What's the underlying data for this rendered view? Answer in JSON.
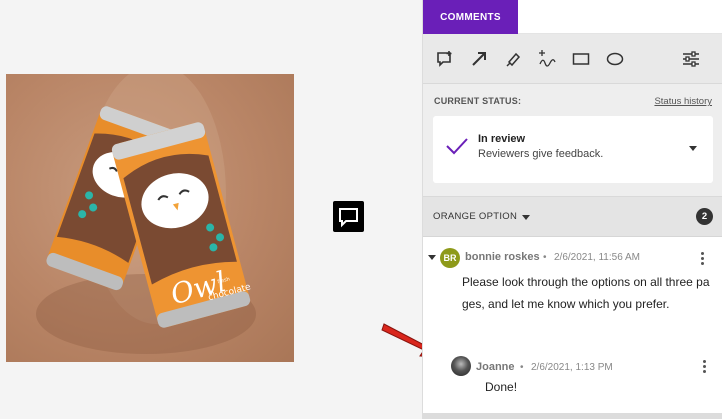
{
  "tabs": {
    "comments_label": "COMMENTS"
  },
  "toolbar": {
    "tools": [
      "add-comment-icon",
      "arrow-icon",
      "highlighter-icon",
      "freehand-icon",
      "rectangle-icon",
      "ellipse-icon",
      "filter-settings-icon"
    ]
  },
  "status": {
    "section_label": "CURRENT STATUS:",
    "history_link": "Status history",
    "title": "In review",
    "subtitle": "Reviewers give feedback.",
    "check_color": "#6a1fb8"
  },
  "group": {
    "title": "ORANGE OPTION",
    "count": "2"
  },
  "comment": {
    "avatar_initials": "BR",
    "author": "bonnie roskes",
    "separator": "•",
    "timestamp": "2/6/2021, 11:56 AM",
    "body": "Please look through the options on all three pages, and let me know which you prefer."
  },
  "reply": {
    "author": "Joanne",
    "separator": "•",
    "timestamp": "2/6/2021, 1:13 PM",
    "body": "Done!"
  },
  "artwork": {
    "can_brand": "Owl",
    "can_flavor": "chocolate",
    "can_small": "fresh"
  },
  "colors": {
    "accent": "#6a1fb8",
    "annotation_arrow": "#d9261c"
  }
}
